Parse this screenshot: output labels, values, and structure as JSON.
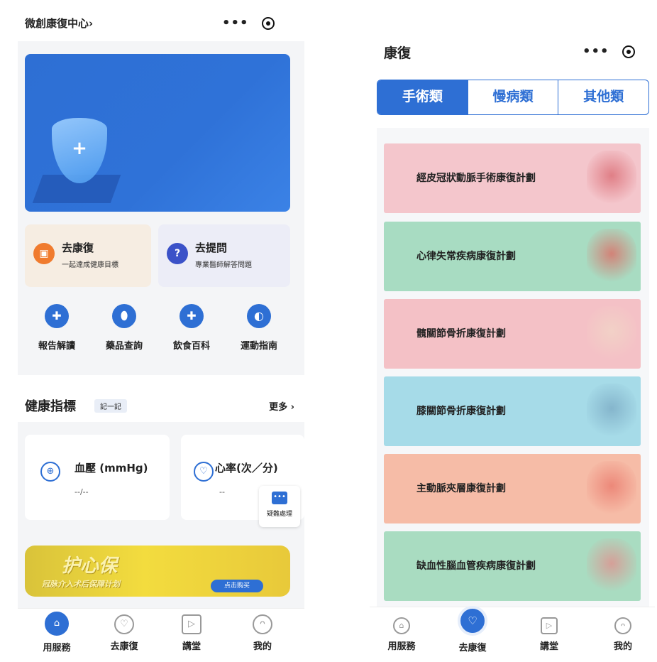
{
  "left": {
    "header": {
      "title": "微創康復中心",
      "chevron": "›",
      "more_icon": "•••"
    },
    "quick_actions": [
      {
        "title": "去康復",
        "subtitle": "一起達成健康目標",
        "icon": "camera-icon",
        "color": "#f07b2e",
        "bg": "#f6ede2"
      },
      {
        "title": "去提問",
        "subtitle": "專業醫師解答問題",
        "icon": "question-icon",
        "color": "#3b52c8",
        "bg": "#ecedf7"
      }
    ],
    "grid": [
      {
        "label": "報告解讀",
        "icon": "bulb-icon"
      },
      {
        "label": "藥品查詢",
        "icon": "pill-icon"
      },
      {
        "label": "飲食百科",
        "icon": "food-icon"
      },
      {
        "label": "運動指南",
        "icon": "ball-icon"
      }
    ],
    "health_section": {
      "title": "健康指標",
      "tag": "記一記",
      "more": "更多 ›"
    },
    "metrics": [
      {
        "title": "血壓 (mmHg)",
        "value": "--/--",
        "icon": "stethoscope-icon"
      },
      {
        "title": "心率(次／分)",
        "value": "--",
        "icon": "heart-rate-icon"
      }
    ],
    "float_button": {
      "label": "疑難處理",
      "icon": "chat-icon"
    },
    "promo": {
      "title": "护心保",
      "subtitle": "冠脉介入术后保障计划",
      "button": "点击购买"
    },
    "tabbar": [
      {
        "label": "用服務",
        "icon": "home-icon",
        "active": true
      },
      {
        "label": "去康復",
        "icon": "heart-hand-icon",
        "active": false
      },
      {
        "label": "講堂",
        "icon": "video-icon",
        "active": false
      },
      {
        "label": "我的",
        "icon": "person-icon",
        "active": false
      }
    ]
  },
  "right": {
    "header": {
      "title": "康復",
      "more_icon": "•••"
    },
    "segments": [
      {
        "label": "手術類",
        "active": true
      },
      {
        "label": "慢病類",
        "active": false
      },
      {
        "label": "其他類",
        "active": false
      }
    ],
    "plans": [
      {
        "label": "經皮冠狀動脈手術康復計劃",
        "bg": "#f4c6cc",
        "art": "#d9676f"
      },
      {
        "label": "心律失常疾病康復計劃",
        "bg": "#a8dcc2",
        "art": "#e0655f"
      },
      {
        "label": "髖關節骨折康復計劃",
        "bg": "#f4c1c6",
        "art": "#f1d6c7"
      },
      {
        "label": "膝關節骨折康復計劃",
        "bg": "#a6dbe8",
        "art": "#7aa9c3"
      },
      {
        "label": "主動脈夾層康復計劃",
        "bg": "#f6bca7",
        "art": "#e9776a"
      },
      {
        "label": "缺血性腦血管疾病康復計劃",
        "bg": "#a9dcc1",
        "art": "#e48b8a"
      }
    ],
    "tabbar": [
      {
        "label": "用服務",
        "icon": "home-icon",
        "active": false
      },
      {
        "label": "去康復",
        "icon": "heart-hand-icon",
        "active": true
      },
      {
        "label": "講堂",
        "icon": "video-icon",
        "active": false
      },
      {
        "label": "我的",
        "icon": "person-icon",
        "active": false
      }
    ]
  }
}
